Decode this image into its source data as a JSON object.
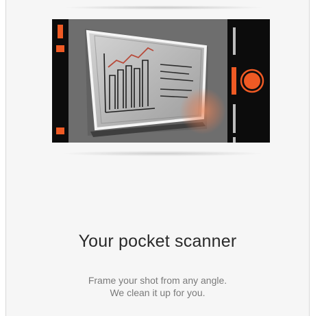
{
  "onboarding": {
    "headline": "Your pocket scanner",
    "subtext_line1": "Frame your shot from any angle.",
    "subtext_line2": "We clean it up for you."
  },
  "illustration": {
    "icons": [
      "whiteboard-icon",
      "bar-chart-icon",
      "shutter-button-icon"
    ],
    "colors": {
      "accent": "#ef5a24",
      "camera_bar": "#0c0c0c",
      "viewfinder_bg": "#6e6e6e",
      "board_frame": "#f2f2f2"
    }
  }
}
